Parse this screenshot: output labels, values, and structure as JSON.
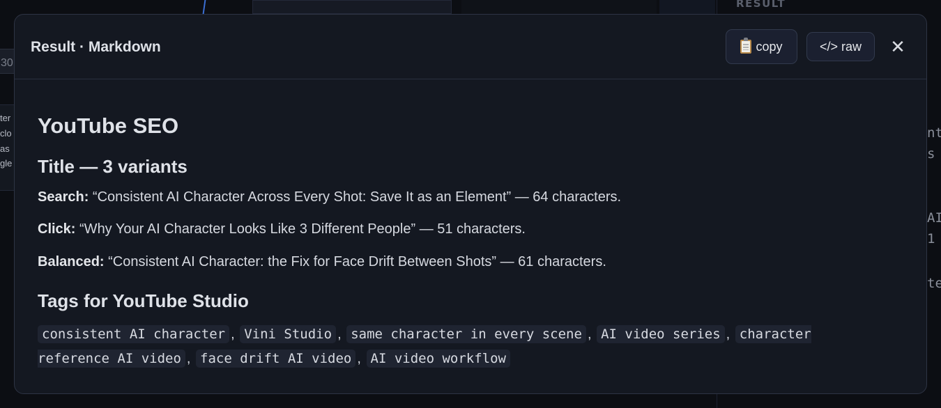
{
  "background": {
    "right_panel_label": "RESULT",
    "left_number": "30",
    "left_text_lines": [
      "ter",
      "clo",
      "as",
      "gle"
    ],
    "right_text_lines": [
      "nt",
      "s",
      "AI",
      "1",
      "te"
    ]
  },
  "modal": {
    "title": "Result · Markdown",
    "copy_label": "copy",
    "raw_label": "</> raw",
    "close_glyph": "✕"
  },
  "content": {
    "heading": "YouTube SEO",
    "title_section": {
      "heading": "Title — 3 variants",
      "variants": [
        {
          "label": "Search:",
          "text": " “Consistent AI Character Across Every Shot: Save It as an Element” — 64 characters."
        },
        {
          "label": "Click:",
          "text": " “Why Your AI Character Looks Like 3 Different People” — 51 characters."
        },
        {
          "label": "Balanced:",
          "text": " “Consistent AI Character: the Fix for Face Drift Between Shots” — 61 characters."
        }
      ]
    },
    "tags_section": {
      "heading": "Tags for YouTube Studio",
      "tags": [
        "consistent AI character",
        "Vini Studio",
        "same character in every scene",
        "AI video series",
        "character reference AI video",
        "face drift AI video",
        "AI video workflow"
      ]
    }
  },
  "colors": {
    "modal_bg": "#141821",
    "tag_bg": "#1f2431",
    "text": "#d6d9e0"
  }
}
